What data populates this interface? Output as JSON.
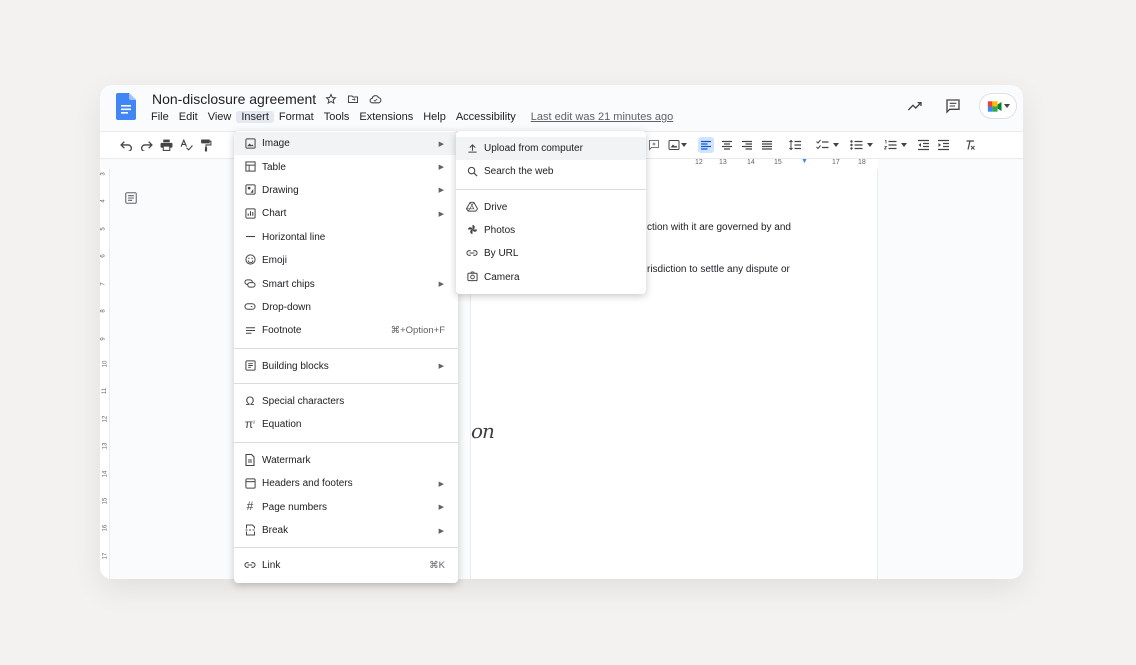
{
  "header": {
    "title": "Non-disclosure agreement",
    "last_edit": "Last edit was 21 minutes ago"
  },
  "menubar": [
    "File",
    "Edit",
    "View",
    "Insert",
    "Format",
    "Tools",
    "Extensions",
    "Help",
    "Accessibility"
  ],
  "active_menu": "Insert",
  "ruler": [
    "12",
    "13",
    "14",
    "15",
    "17",
    "18"
  ],
  "vruler": [
    "3",
    "4",
    "5",
    "6",
    "7",
    "8",
    "9",
    "10",
    "11",
    "12",
    "13",
    "14",
    "15",
    "16",
    "17"
  ],
  "page": {
    "line1": "ction with it are governed by and",
    "line2": "risdiction to settle any dispute or",
    "signature": "on"
  },
  "insert_menu": [
    {
      "label": "Image",
      "icon": "image-icon",
      "arrow": true
    },
    {
      "label": "Table",
      "icon": "table-icon",
      "arrow": true
    },
    {
      "label": "Drawing",
      "icon": "drawing-icon",
      "arrow": true
    },
    {
      "label": "Chart",
      "icon": "chart-icon",
      "arrow": true
    },
    {
      "label": "Horizontal line",
      "icon": "horizontal-line-icon"
    },
    {
      "label": "Emoji",
      "icon": "emoji-icon"
    },
    {
      "label": "Smart chips",
      "icon": "smart-chips-icon",
      "arrow": true
    },
    {
      "label": "Drop-down",
      "icon": "dropdown-icon"
    },
    {
      "label": "Footnote",
      "icon": "footnote-icon",
      "shortcut": "⌘+Option+F"
    },
    {
      "label": "Building blocks",
      "icon": "building-blocks-icon",
      "arrow": true
    },
    {
      "label": "Special characters",
      "icon": "omega-icon"
    },
    {
      "label": "Equation",
      "icon": "pi-icon"
    },
    {
      "label": "Watermark",
      "icon": "watermark-icon"
    },
    {
      "label": "Headers and footers",
      "icon": "header-footer-icon",
      "arrow": true
    },
    {
      "label": "Page numbers",
      "icon": "hash-icon",
      "arrow": true
    },
    {
      "label": "Break",
      "icon": "break-icon",
      "arrow": true
    },
    {
      "label": "Link",
      "icon": "link-icon",
      "shortcut": "⌘K"
    }
  ],
  "image_submenu": [
    {
      "label": "Upload from computer",
      "icon": "upload-icon"
    },
    {
      "label": "Search the web",
      "icon": "search-icon"
    },
    {
      "label": "Drive",
      "icon": "drive-icon"
    },
    {
      "label": "Photos",
      "icon": "photos-icon"
    },
    {
      "label": "By URL",
      "icon": "link-icon"
    },
    {
      "label": "Camera",
      "icon": "camera-icon"
    }
  ]
}
